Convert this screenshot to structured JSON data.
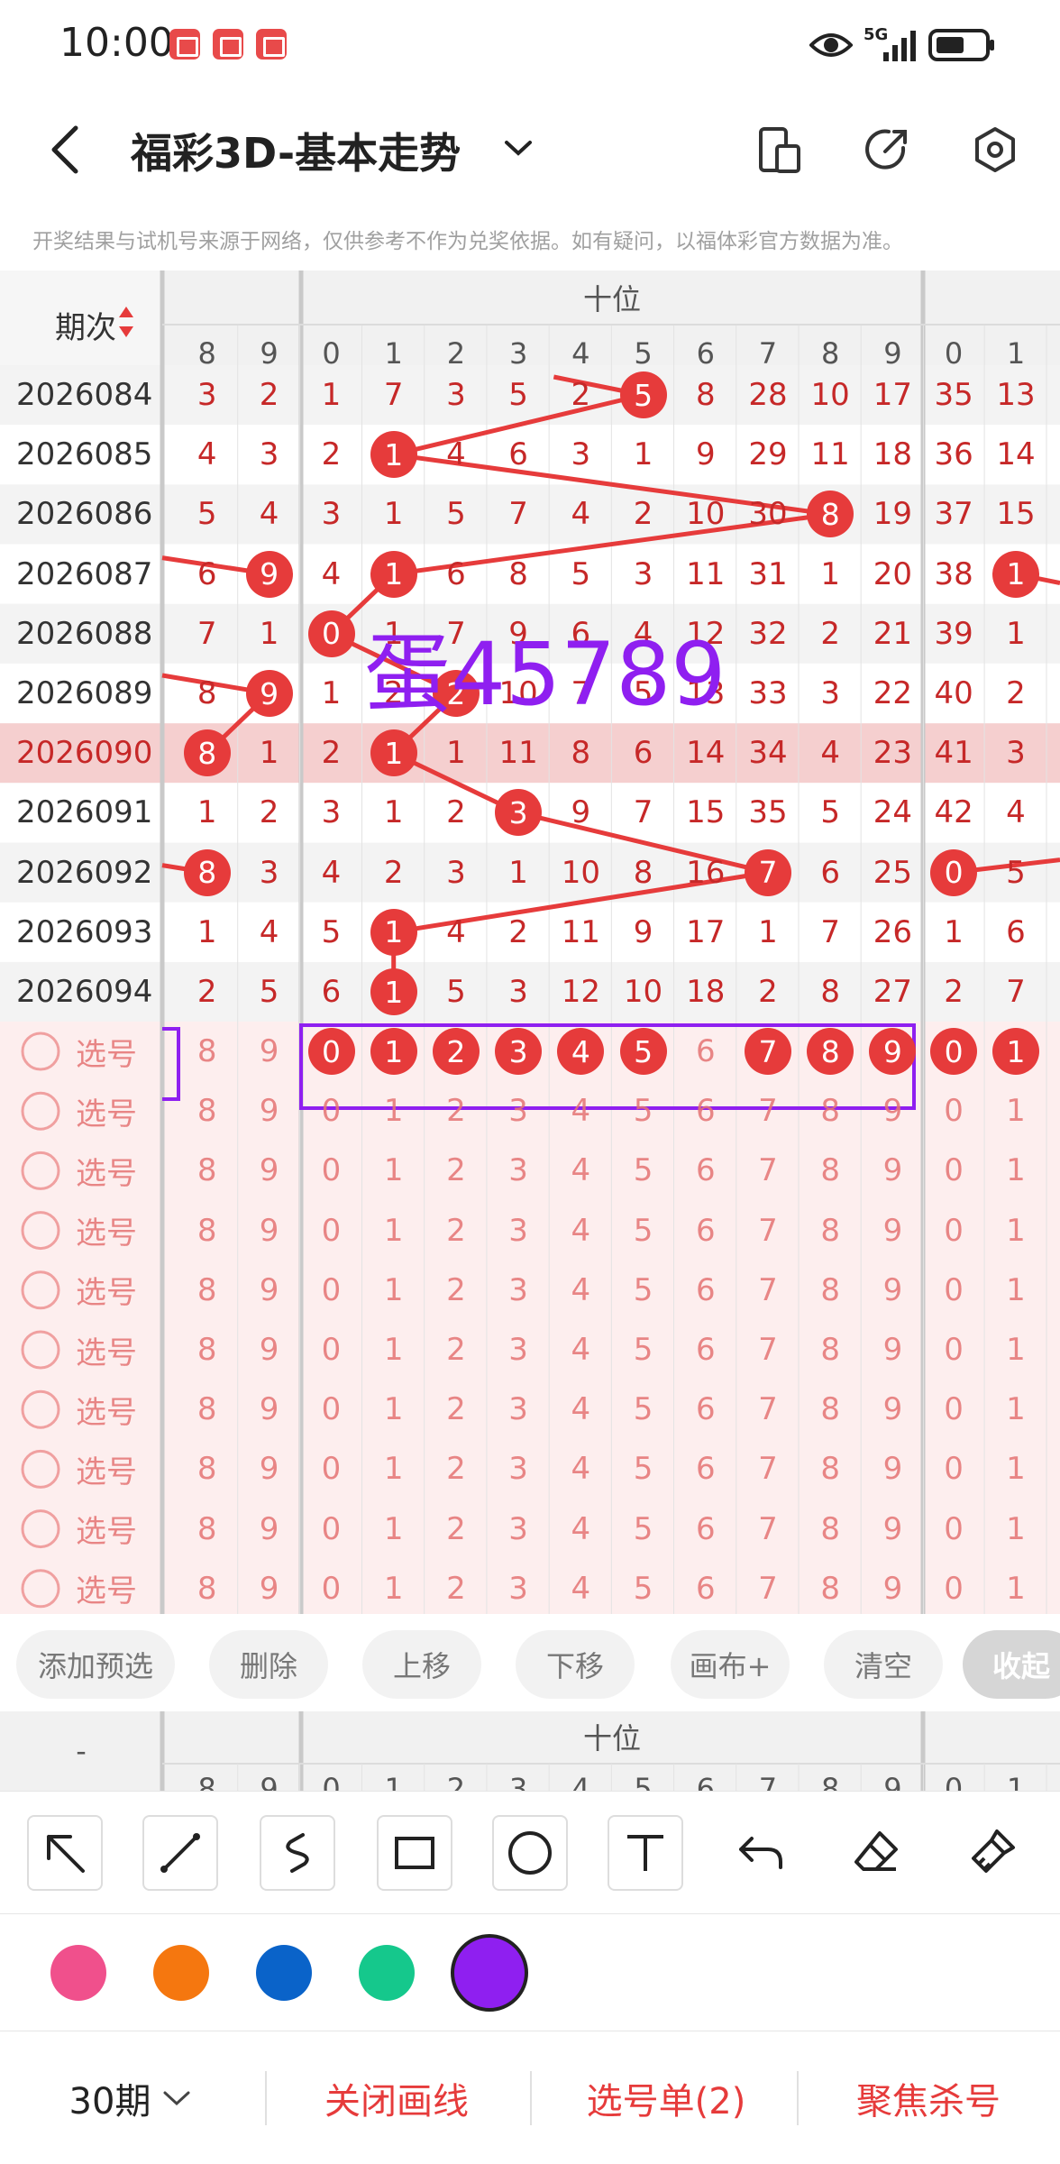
{
  "status_bar": {
    "time": "10:00",
    "network": "5G",
    "icons": [
      "reader-app-icon",
      "reader-app-icon",
      "huawei-app-icon",
      "eye-icon",
      "signal-icon",
      "battery-icon"
    ]
  },
  "header": {
    "title": "福彩3D-基本走势",
    "icons": [
      "back-icon",
      "chevron-down-icon",
      "phone-layout-icon",
      "share-icon",
      "settings-icon"
    ]
  },
  "disclaimer": "开奖结果与试机号来源于网络，仅供参考不作为兑奖依据。如有疑问，以福体彩官方数据为准。",
  "table": {
    "period_header": "期次",
    "group_label": "十位",
    "prev_group_cols": [
      "8",
      "9"
    ],
    "group_cols": [
      "0",
      "1",
      "2",
      "3",
      "4",
      "5",
      "6",
      "7",
      "8",
      "9"
    ],
    "next_group_cols": [
      "0",
      "1"
    ],
    "rows": [
      {
        "period": "2026084",
        "prev": [
          "3",
          "2"
        ],
        "tens": [
          "1",
          "7",
          "3",
          "5",
          "2",
          "5",
          "8",
          "28",
          "10",
          "17"
        ],
        "next": [
          "35",
          "13"
        ]
      },
      {
        "period": "2026085",
        "prev": [
          "4",
          "3"
        ],
        "tens": [
          "2",
          "1",
          "4",
          "6",
          "3",
          "1",
          "9",
          "29",
          "11",
          "18"
        ],
        "next": [
          "36",
          "14"
        ]
      },
      {
        "period": "2026086",
        "prev": [
          "5",
          "4"
        ],
        "tens": [
          "3",
          "1",
          "5",
          "7",
          "4",
          "2",
          "10",
          "30",
          "8",
          "19"
        ],
        "next": [
          "37",
          "15"
        ]
      },
      {
        "period": "2026087",
        "prev": [
          "6",
          "9"
        ],
        "tens": [
          "4",
          "1",
          "6",
          "8",
          "5",
          "3",
          "11",
          "31",
          "1",
          "20"
        ],
        "next": [
          "38",
          "1"
        ]
      },
      {
        "period": "2026088",
        "prev": [
          "7",
          "1"
        ],
        "tens": [
          "0",
          "1",
          "7",
          "9",
          "6",
          "4",
          "12",
          "32",
          "2",
          "21"
        ],
        "next": [
          "39",
          "1"
        ]
      },
      {
        "period": "2026089",
        "prev": [
          "8",
          "9"
        ],
        "tens": [
          "1",
          "2",
          "2",
          "10",
          "7",
          "5",
          "13",
          "33",
          "3",
          "22"
        ],
        "next": [
          "40",
          "2"
        ]
      },
      {
        "period": "2026090",
        "prev": [
          "8",
          "1"
        ],
        "tens": [
          "2",
          "1",
          "1",
          "11",
          "8",
          "6",
          "14",
          "34",
          "4",
          "23"
        ],
        "next": [
          "41",
          "3"
        ]
      },
      {
        "period": "2026091",
        "prev": [
          "1",
          "2"
        ],
        "tens": [
          "3",
          "1",
          "2",
          "3",
          "9",
          "7",
          "15",
          "35",
          "5",
          "24"
        ],
        "next": [
          "42",
          "4"
        ]
      },
      {
        "period": "2026092",
        "prev": [
          "8",
          "3"
        ],
        "tens": [
          "4",
          "2",
          "3",
          "1",
          "10",
          "8",
          "16",
          "7",
          "6",
          "25"
        ],
        "next": [
          "0",
          "5"
        ]
      },
      {
        "period": "2026093",
        "prev": [
          "1",
          "4"
        ],
        "tens": [
          "5",
          "1",
          "4",
          "2",
          "11",
          "9",
          "17",
          "1",
          "7",
          "26"
        ],
        "next": [
          "1",
          "6"
        ]
      },
      {
        "period": "2026094",
        "prev": [
          "2",
          "5"
        ],
        "tens": [
          "6",
          "1",
          "5",
          "3",
          "12",
          "10",
          "18",
          "2",
          "8",
          "27"
        ],
        "next": [
          "2",
          "7"
        ]
      }
    ],
    "pick_label": "选号",
    "pick_rows": 10
  },
  "annotation_text": "蛋45789",
  "actions": {
    "add_preselect": "添加预选",
    "delete": "删除",
    "move_up": "上移",
    "move_down": "下移",
    "canvas_plus": "画布+",
    "clear": "清空",
    "collapse": "收起"
  },
  "bottom_grid": {
    "period_header": "-",
    "group_label": "十位"
  },
  "draw_tools": [
    "arrow-tool-icon",
    "line-tool-icon",
    "curve-tool-icon",
    "rectangle-tool-icon",
    "circle-tool-icon",
    "text-tool-icon",
    "undo-icon",
    "eraser-icon",
    "clear-brush-icon"
  ],
  "colors": {
    "brush_colors": [
      "#f0508c",
      "#f5770f",
      "#0a63c9",
      "#15c88c",
      "#8f1ff0"
    ],
    "selected_color": "#8f1ff0",
    "accent_red": "#e63b3b"
  },
  "bottom_bar": {
    "periods": "30期",
    "close_drawing": "关闭画线",
    "pick_list": "选号单(2)",
    "focus_kill": "聚焦杀号"
  }
}
